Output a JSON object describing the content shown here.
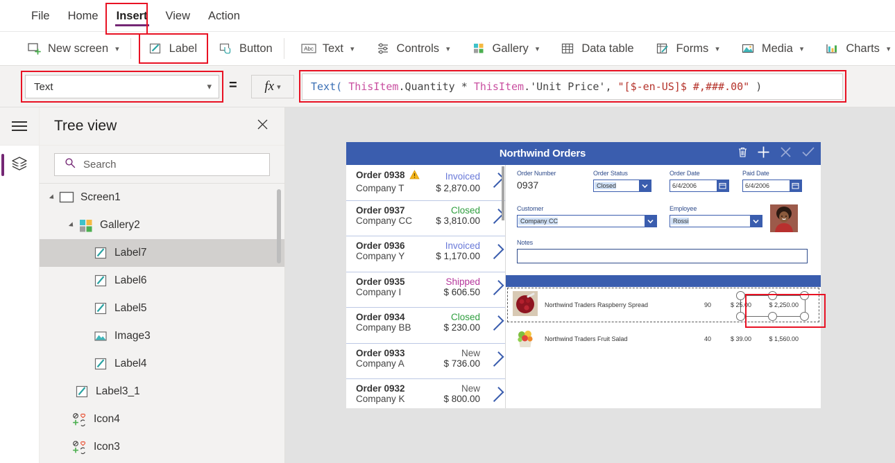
{
  "menu": {
    "items": [
      {
        "label": "File",
        "active": false
      },
      {
        "label": "Home",
        "active": false
      },
      {
        "label": "Insert",
        "active": true
      },
      {
        "label": "View",
        "active": false
      },
      {
        "label": "Action",
        "active": false
      }
    ]
  },
  "ribbon": {
    "items": [
      {
        "label": "New screen",
        "icon": "new-screen-icon",
        "caret": true
      },
      {
        "label": "Label",
        "icon": "label-icon",
        "caret": false
      },
      {
        "label": "Button",
        "icon": "button-icon",
        "caret": false
      },
      {
        "label": "Text",
        "icon": "text-icon",
        "caret": true
      },
      {
        "label": "Controls",
        "icon": "controls-icon",
        "caret": true
      },
      {
        "label": "Gallery",
        "icon": "gallery-icon",
        "caret": true
      },
      {
        "label": "Data table",
        "icon": "data-table-icon",
        "caret": false
      },
      {
        "label": "Forms",
        "icon": "forms-icon",
        "caret": true
      },
      {
        "label": "Media",
        "icon": "media-icon",
        "caret": true
      },
      {
        "label": "Charts",
        "icon": "charts-icon",
        "caret": true
      }
    ]
  },
  "formula_bar": {
    "property": "Text",
    "equals": "=",
    "fx_label": "fx",
    "formula_tokens": [
      {
        "t": "Text(",
        "c": "fn"
      },
      {
        "t": " ",
        "c": "op"
      },
      {
        "t": "ThisItem",
        "c": "id"
      },
      {
        "t": ".Quantity ",
        "c": "prop"
      },
      {
        "t": "* ",
        "c": "op"
      },
      {
        "t": "ThisItem",
        "c": "id"
      },
      {
        "t": ".'Unit Price', ",
        "c": "prop"
      },
      {
        "t": "\"[$-en-US]$ #,###.00\"",
        "c": "str"
      },
      {
        "t": " )",
        "c": "op"
      }
    ],
    "formula_text": "Text( ThisItem.Quantity * ThisItem.'Unit Price', \"[$-en-US]$ #,###.00\" )"
  },
  "rail": {
    "hamburger": "hamburger-icon",
    "layers": "layers-icon"
  },
  "tree_view": {
    "title": "Tree view",
    "close": "close-icon",
    "search_placeholder": "Search",
    "search_value": "",
    "items": [
      {
        "label": "Screen1",
        "icon": "screen-icon",
        "indent": 0,
        "expander": true,
        "selected": false
      },
      {
        "label": "Gallery2",
        "icon": "gallery-icon",
        "indent": 1,
        "expander": true,
        "selected": false
      },
      {
        "label": "Label7",
        "icon": "label-icon",
        "indent": 2,
        "expander": false,
        "selected": true
      },
      {
        "label": "Label6",
        "icon": "label-icon",
        "indent": 2,
        "expander": false,
        "selected": false
      },
      {
        "label": "Label5",
        "icon": "label-icon",
        "indent": 2,
        "expander": false,
        "selected": false
      },
      {
        "label": "Image3",
        "icon": "image-icon",
        "indent": 2,
        "expander": false,
        "selected": false
      },
      {
        "label": "Label4",
        "icon": "label-icon",
        "indent": 2,
        "expander": false,
        "selected": false
      },
      {
        "label": "Label3_1",
        "icon": "label-icon",
        "indent": 1,
        "expander": false,
        "selected": false
      },
      {
        "label": "Icon4",
        "icon": "icon-icon",
        "indent": 1,
        "expander": false,
        "selected": false
      },
      {
        "label": "Icon3",
        "icon": "icon-icon",
        "indent": 1,
        "expander": false,
        "selected": false
      }
    ]
  },
  "app": {
    "title": "Northwind Orders",
    "header_icons": [
      "trash-icon",
      "plus-icon",
      "cancel-icon",
      "check-icon"
    ],
    "orders": [
      {
        "number": "Order 0938",
        "company": "Company T",
        "status": "Invoiced",
        "amount": "$ 2,870.00",
        "status_color": "#6878d8",
        "warning": true
      },
      {
        "number": "Order 0937",
        "company": "Company CC",
        "status": "Closed",
        "amount": "$ 3,810.00",
        "status_color": "#2e9e3e",
        "warning": false
      },
      {
        "number": "Order 0936",
        "company": "Company Y",
        "status": "Invoiced",
        "amount": "$ 1,170.00",
        "status_color": "#6878d8",
        "warning": false
      },
      {
        "number": "Order 0935",
        "company": "Company I",
        "status": "Shipped",
        "amount": "$ 606.50",
        "status_color": "#b5369b",
        "warning": false
      },
      {
        "number": "Order 0934",
        "company": "Company BB",
        "status": "Closed",
        "amount": "$ 230.00",
        "status_color": "#2e9e3e",
        "warning": false
      },
      {
        "number": "Order 0933",
        "company": "Company A",
        "status": "New",
        "amount": "$ 736.00",
        "status_color": "#5a5a5a",
        "warning": false
      },
      {
        "number": "Order 0932",
        "company": "Company K",
        "status": "New",
        "amount": "$ 800.00",
        "status_color": "#5a5a5a",
        "warning": false
      }
    ],
    "form": {
      "order_number_label": "Order Number",
      "order_number_value": "0937",
      "order_status_label": "Order Status",
      "order_status_value": "Closed",
      "order_date_label": "Order Date",
      "order_date_value": "6/4/2006",
      "paid_date_label": "Paid Date",
      "paid_date_value": "6/4/2006",
      "customer_label": "Customer",
      "customer_value": "Company CC",
      "employee_label": "Employee",
      "employee_value": "Rossi",
      "notes_label": "Notes",
      "notes_value": "",
      "employee_photo": "employee-photo"
    },
    "line_items": [
      {
        "product": "Northwind Traders Raspberry Spread",
        "quantity": "90",
        "unit_price": "$ 25.00",
        "total": "$ 2,250.00",
        "selected": true
      },
      {
        "product": "Northwind Traders Fruit Salad",
        "quantity": "40",
        "unit_price": "$ 39.00",
        "total": "$ 1,560.00",
        "selected": false
      }
    ]
  },
  "colors": {
    "accent_purple": "#742774",
    "app_blue": "#3a5dae",
    "annotation_red": "#e81123",
    "canvas_gray": "#e2e2e2"
  }
}
